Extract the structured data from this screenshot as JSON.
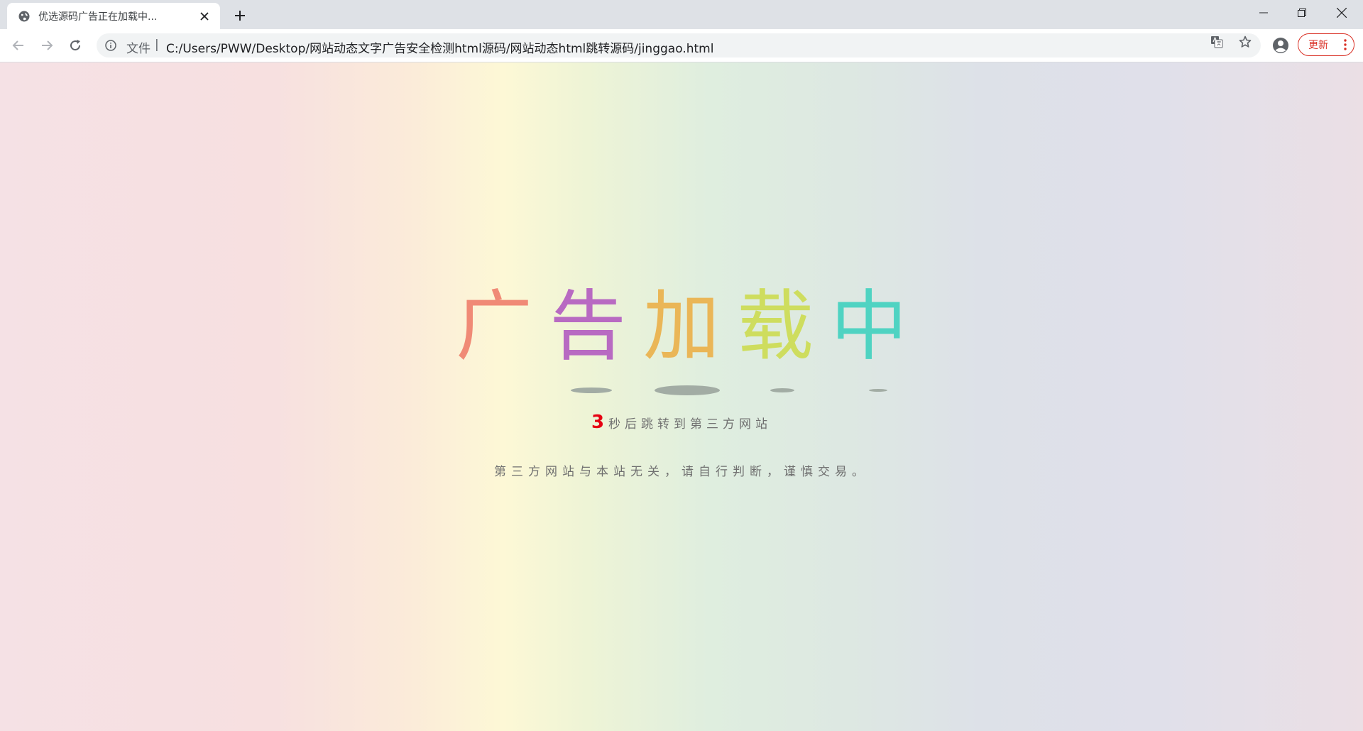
{
  "browser": {
    "tab": {
      "title": "优选源码广告正在加载中..."
    },
    "address": {
      "scheme_label": "文件",
      "separator": "|",
      "url": "C:/Users/PWW/Desktop/网站动态文字广告安全检测html源码/网站动态html跳转源码/jinggao.html"
    },
    "update_label": "更新"
  },
  "page": {
    "headline": [
      {
        "char": "广",
        "color": "#f08a76"
      },
      {
        "char": "告",
        "color": "#b86ac2"
      },
      {
        "char": "加",
        "color": "#eab657"
      },
      {
        "char": "载",
        "color": "#cedd5e"
      },
      {
        "char": "中",
        "color": "#4fd3c2"
      }
    ],
    "countdown": {
      "seconds": "3",
      "text": "秒后跳转到第三方网站"
    },
    "notice": "第三方网站与本站无关，请自行判断，谨慎交易。"
  }
}
